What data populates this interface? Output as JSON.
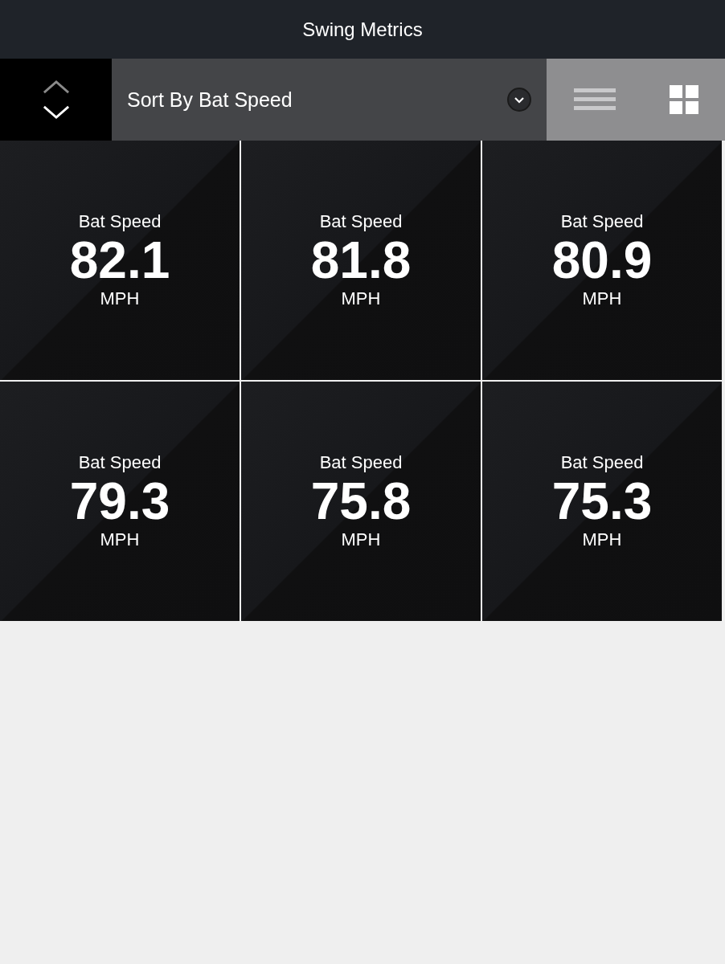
{
  "header": {
    "title": "Swing Metrics"
  },
  "sort_arrows": [
    {
      "kind": "up",
      "selected": false
    },
    {
      "kind": "down",
      "selected": true
    }
  ],
  "sort_dropdown": {
    "value": "Sort By Bat Speed"
  },
  "view_options": [
    {
      "kind": "list",
      "selected": false
    },
    {
      "kind": "grid",
      "selected": true
    }
  ],
  "tiles": [
    {
      "label": "Bat Speed",
      "value": "82.1",
      "unit": "MPH"
    },
    {
      "label": "Bat Speed",
      "value": "81.8",
      "unit": "MPH"
    },
    {
      "label": "Bat Speed",
      "value": "80.9",
      "unit": "MPH"
    },
    {
      "label": "Bat Speed",
      "value": "79.3",
      "unit": "MPH"
    },
    {
      "label": "Bat Speed",
      "value": "75.8",
      "unit": "MPH"
    },
    {
      "label": "Bat Speed",
      "value": "75.3",
      "unit": "MPH"
    }
  ]
}
